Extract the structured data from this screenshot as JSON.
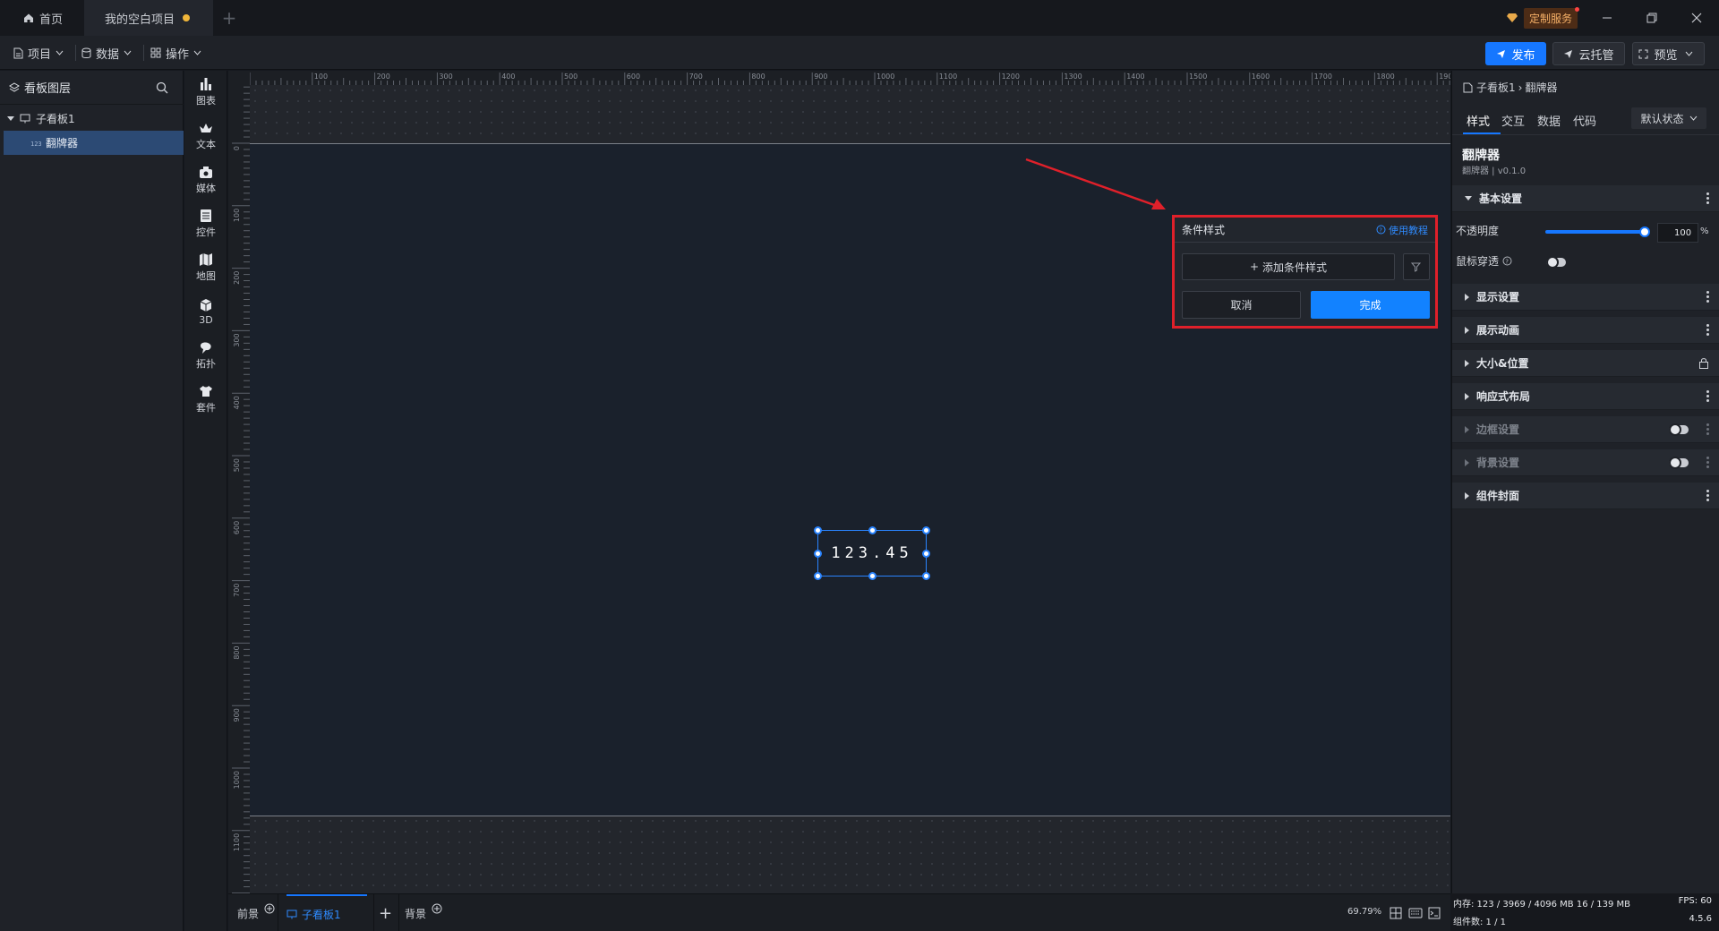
{
  "titlebar": {
    "home_tab": "首页",
    "project_tab": "我的空白项目",
    "custom_service": "定制服务"
  },
  "toolbar": {
    "menu_project": "项目",
    "menu_data": "数据",
    "menu_operate": "操作",
    "publish": "发布",
    "cloud": "云托管",
    "preview": "预览"
  },
  "layers": {
    "title": "看板图层",
    "items": [
      {
        "label": "子看板1"
      },
      {
        "label": "翻牌器"
      }
    ]
  },
  "library": [
    {
      "label": "图表",
      "icon": "bar-chart-icon"
    },
    {
      "label": "文本",
      "icon": "text-icon"
    },
    {
      "label": "媒体",
      "icon": "media-icon"
    },
    {
      "label": "控件",
      "icon": "control-icon"
    },
    {
      "label": "地图",
      "icon": "map-icon"
    },
    {
      "label": "3D",
      "icon": "cube-icon"
    },
    {
      "label": "拓扑",
      "icon": "topology-icon"
    },
    {
      "label": "套件",
      "icon": "kit-icon"
    }
  ],
  "ruler": {
    "h": [
      "100",
      "200",
      "300",
      "400",
      "500",
      "600",
      "700",
      "800",
      "900",
      "1000",
      "1100",
      "1200",
      "1300",
      "1400",
      "1500",
      "1600",
      "1700",
      "1800",
      "1900"
    ],
    "v": [
      "0",
      "100",
      "200",
      "300",
      "400",
      "500",
      "600",
      "700",
      "800",
      "900",
      "1000",
      "1100"
    ]
  },
  "canvas": {
    "flip_value": "123.45"
  },
  "popover": {
    "title": "条件样式",
    "help": "使用教程",
    "add": "添加条件样式",
    "cancel": "取消",
    "done": "完成"
  },
  "bottom": {
    "foreground": "前景",
    "board_tab": "子看板1",
    "background": "背景",
    "zoom": "69.79%"
  },
  "rpanel": {
    "breadcrumb_parent": "子看板1",
    "breadcrumb_current": "翻牌器",
    "tabs": [
      "样式",
      "交互",
      "数据",
      "代码"
    ],
    "state": "默认状态",
    "comp_title": "翻牌器",
    "comp_sub": "翻牌器 | v0.1.0",
    "sections": {
      "basic": "基本设置",
      "display": "显示设置",
      "animation": "展示动画",
      "size": "大小&位置",
      "responsive": "响应式布局",
      "border": "边框设置",
      "background": "背景设置",
      "cover": "组件封面"
    },
    "opacity_label": "不透明度",
    "opacity_value": "100",
    "opacity_unit": "%",
    "opacity_level": 1.0,
    "mouse_through_label": "鼠标穿透"
  },
  "status": {
    "memory": "内存: 123 / 3969 / 4096 MB 16 / 139 MB",
    "fps": "FPS: 60",
    "components": "组件数: 1 / 1",
    "version": "4.5.6"
  },
  "colors": {
    "accent": "#1677ff",
    "highlight_border": "#e0202a"
  }
}
